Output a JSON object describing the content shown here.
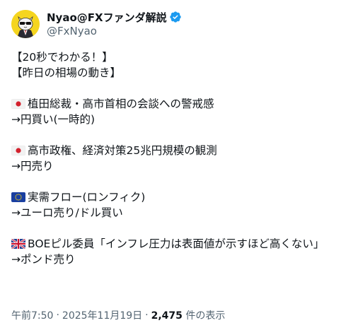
{
  "author": {
    "display_name": "Nyao@FXファンダ解説",
    "handle": "@FxNyao",
    "avatar_icon": "cat-avatar-icon",
    "verified_icon": "verified-badge-icon",
    "verified_color": "#1d9bf0"
  },
  "tweet": {
    "lines": [
      {
        "text": "【20秒でわかる！】"
      },
      {
        "text": "【昨日の相場の動き】"
      },
      {
        "text": ""
      },
      {
        "flag": "jp-flag-icon",
        "text": "植田総裁・高市首相の会談への警戒感"
      },
      {
        "text": "→円買い(一時的)"
      },
      {
        "text": ""
      },
      {
        "flag": "jp-flag-icon",
        "text": "高市政権、経済対策25兆円規模の観測"
      },
      {
        "text": "→円売り"
      },
      {
        "text": ""
      },
      {
        "flag": "eu-flag-icon",
        "text": "実需フロー(ロンフィク)"
      },
      {
        "text": "→ユーロ売り/ドル買い"
      },
      {
        "text": ""
      },
      {
        "flag": "uk-flag-icon",
        "text": "BOEピル委員「インフレ圧力は表面値が示すほど高くない」"
      },
      {
        "text": "→ポンド売り"
      }
    ]
  },
  "meta": {
    "time": "午前7:50",
    "separator": "·",
    "date": "2025年11月19日",
    "views_count": "2,475",
    "views_label": "件の表示"
  },
  "colors": {
    "text_primary": "#0f1419",
    "text_secondary": "#536471"
  }
}
